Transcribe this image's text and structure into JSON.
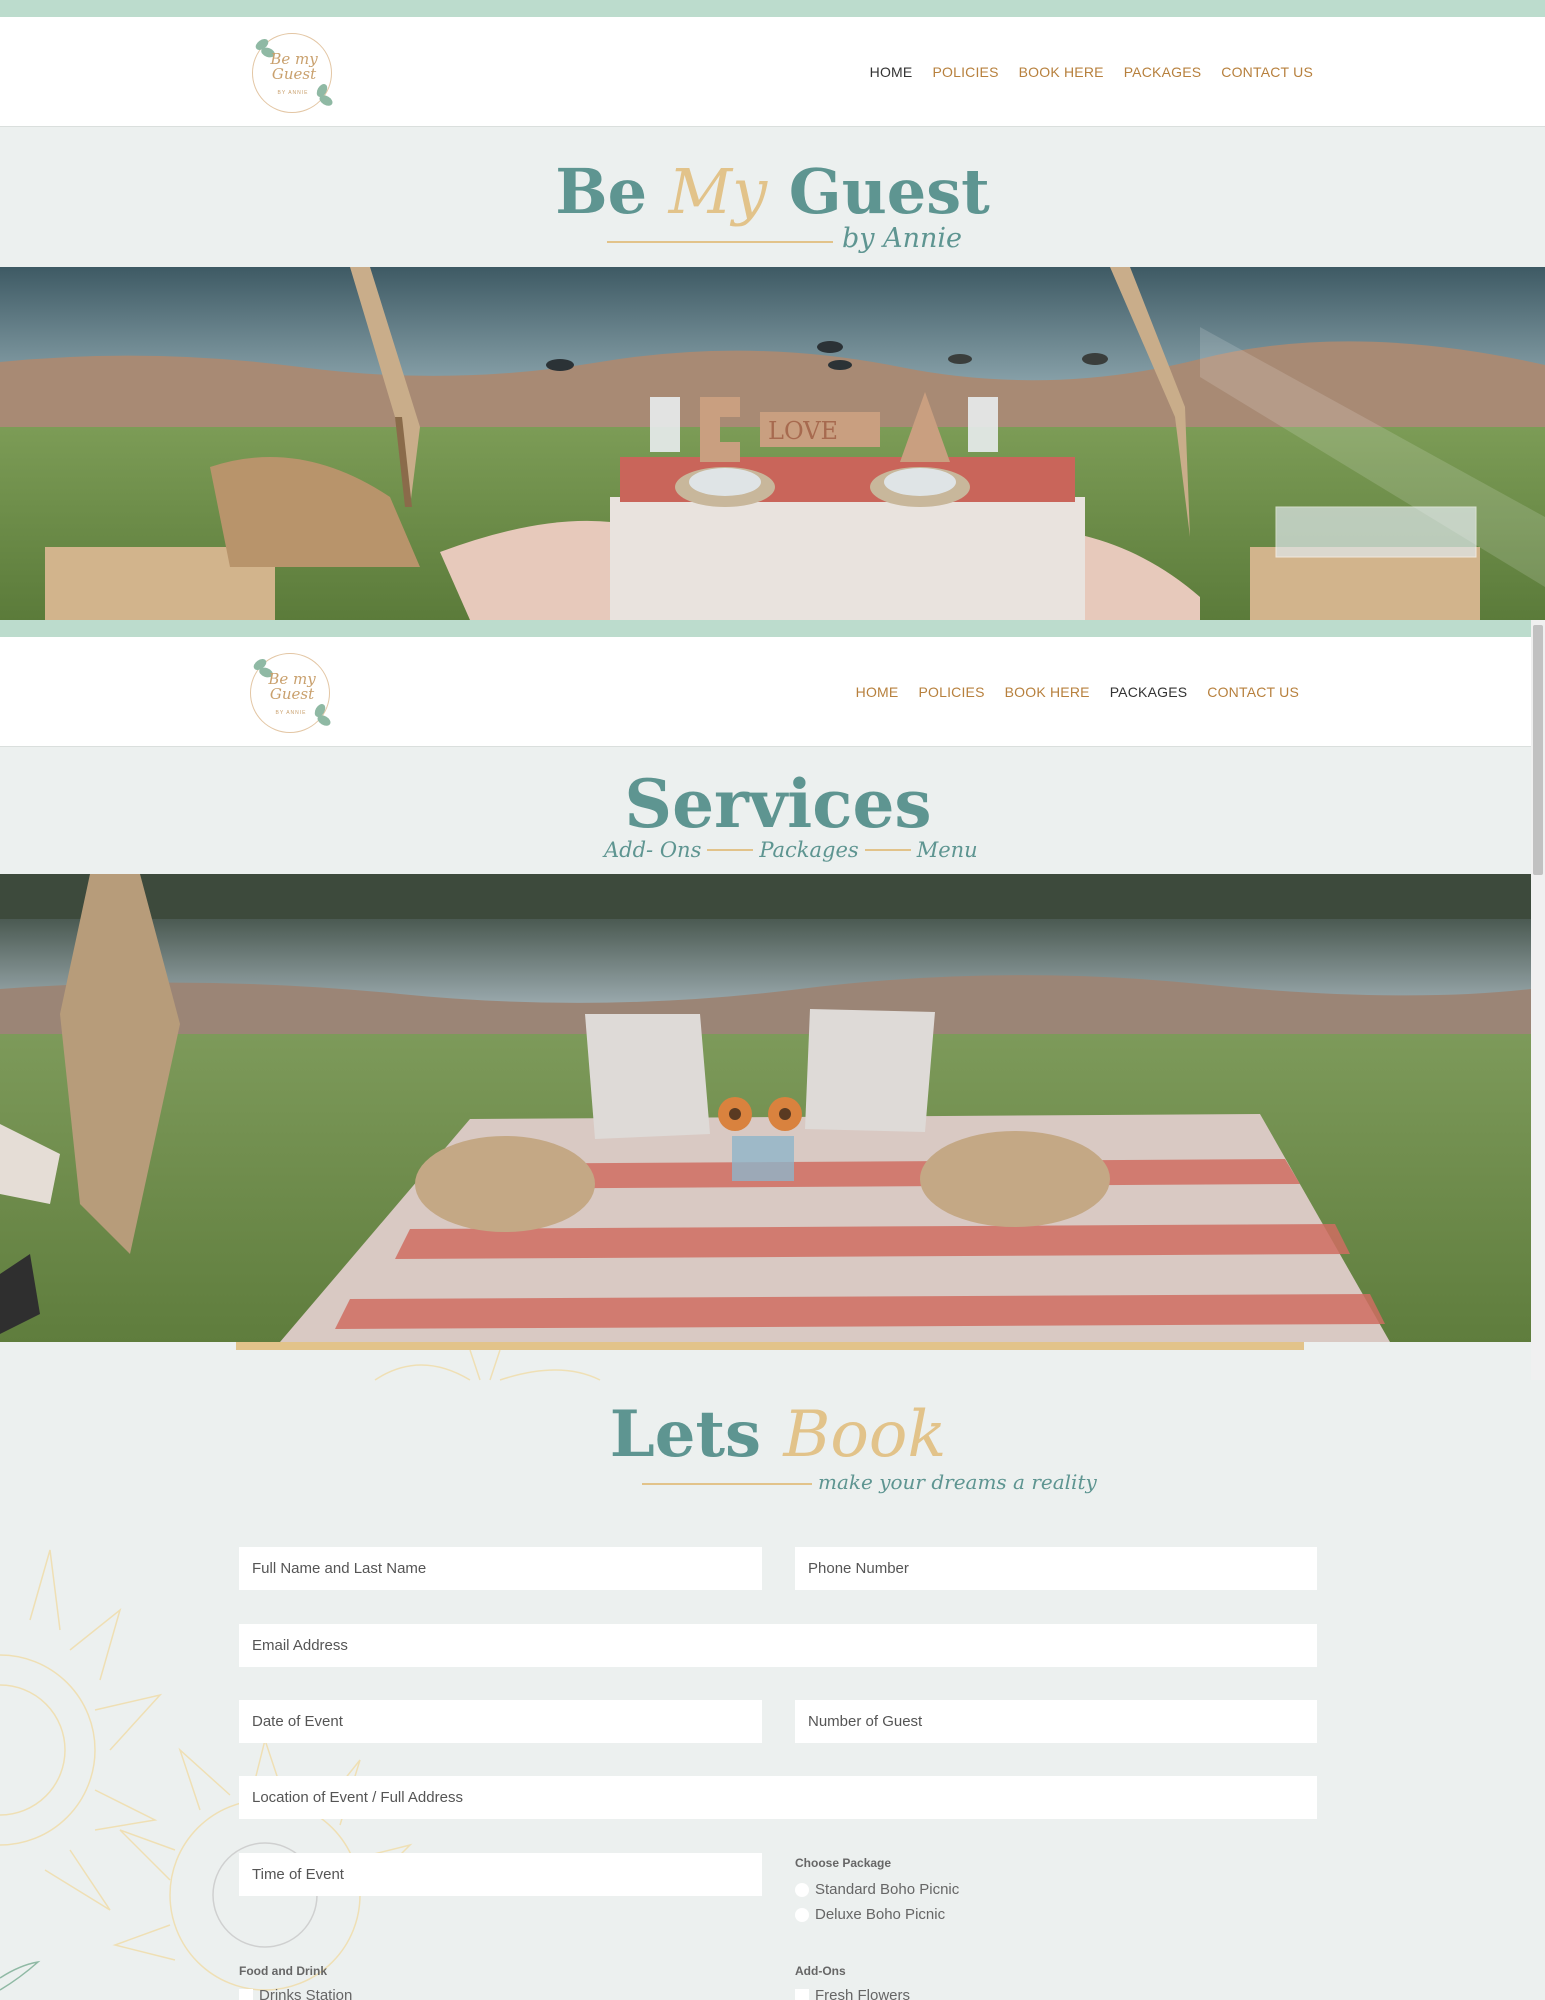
{
  "header": {
    "logo_script": "Be my Guest",
    "logo_tagline": "BY ANNIE",
    "nav": [
      "HOME",
      "POLICIES",
      "BOOK HERE",
      "PACKAGES",
      "CONTACT US"
    ]
  },
  "hero": {
    "title_part1": "Be ",
    "title_part2": "My",
    "title_part3": " Guest",
    "byline": "by Annie"
  },
  "services": {
    "title": "Services",
    "sub1": "Add- Ons",
    "sub2": "Packages",
    "sub3": "Menu"
  },
  "booking": {
    "title_part1": "Lets ",
    "title_part2": "Book",
    "tagline": "make your dreams a reality",
    "fields": {
      "full_name": "Full Name and Last Name",
      "phone": "Phone Number",
      "email": "Email Address",
      "date": "Date of Event",
      "guests": "Number of Guest",
      "location": "Location of Event / Full Address",
      "time": "Time of Event"
    },
    "package_label": "Choose Package",
    "package_options": [
      "Standard Boho Picnic",
      "Deluxe Boho Picnic"
    ],
    "food_label": "Food and Drink",
    "food_options": [
      "Drinks Station"
    ],
    "addons_label": "Add-Ons",
    "addon_options": [
      "Fresh Flowers"
    ]
  },
  "colors": {
    "teal": "#5e9591",
    "gold": "#e2c38a",
    "nav_gold": "#b7803d",
    "mint": "#bcdccd"
  }
}
